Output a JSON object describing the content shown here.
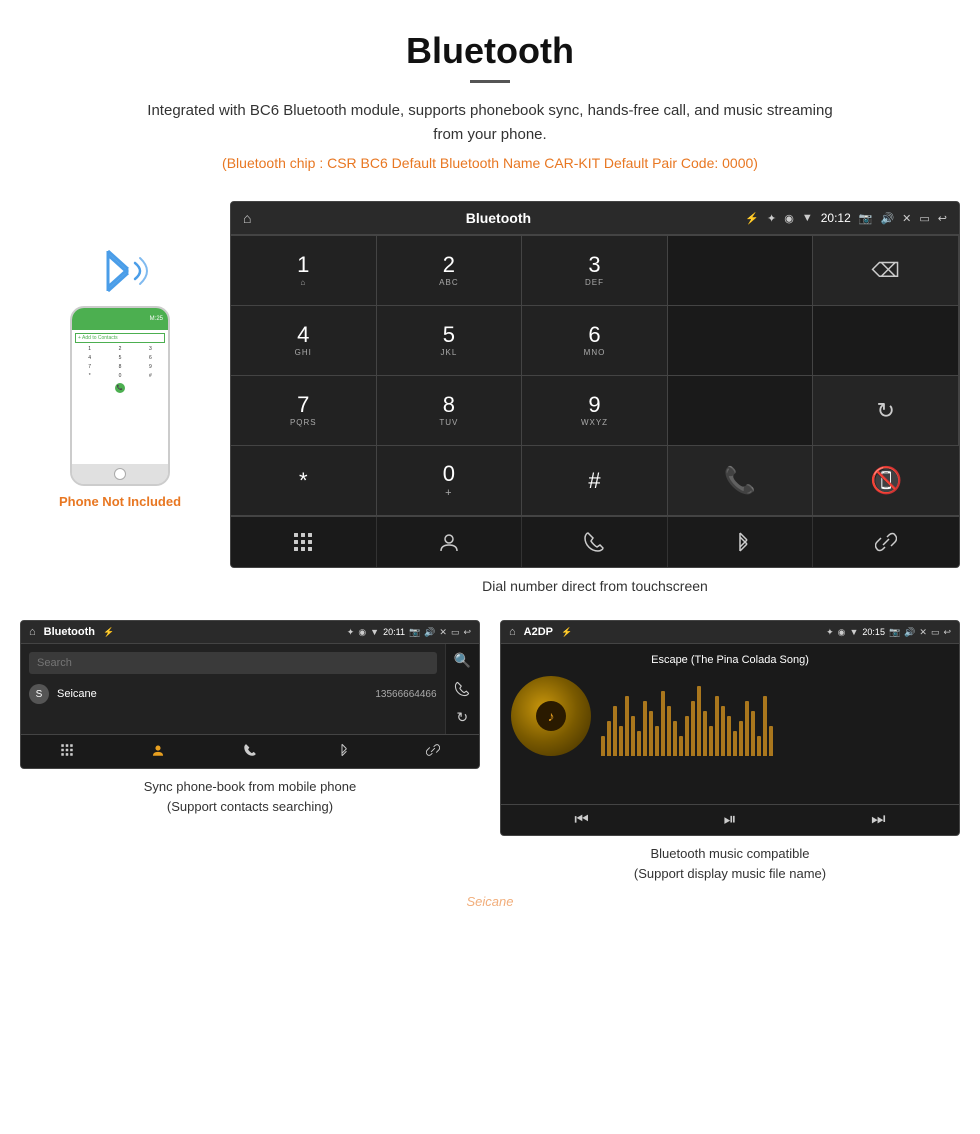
{
  "header": {
    "title": "Bluetooth",
    "description": "Integrated with BC6 Bluetooth module, supports phonebook sync, hands-free call, and music streaming from your phone.",
    "specs": "(Bluetooth chip : CSR BC6    Default Bluetooth Name CAR-KIT    Default Pair Code: 0000)"
  },
  "phone_sidebar": {
    "not_included": "Phone Not Included"
  },
  "dial_screen": {
    "title": "Bluetooth",
    "time": "20:12",
    "caption": "Dial number direct from touchscreen",
    "keys": [
      {
        "num": "1",
        "sub": ""
      },
      {
        "num": "2",
        "sub": "ABC"
      },
      {
        "num": "3",
        "sub": "DEF"
      },
      {
        "num": "4",
        "sub": "GHI"
      },
      {
        "num": "5",
        "sub": "JKL"
      },
      {
        "num": "6",
        "sub": "MNO"
      },
      {
        "num": "7",
        "sub": "PQRS"
      },
      {
        "num": "8",
        "sub": "TUV"
      },
      {
        "num": "9",
        "sub": "WXYZ"
      },
      {
        "num": "*",
        "sub": ""
      },
      {
        "num": "0",
        "sub": "+"
      },
      {
        "num": "#",
        "sub": ""
      }
    ]
  },
  "phonebook_screen": {
    "title": "Bluetooth",
    "time": "20:11",
    "search_placeholder": "Search",
    "contact_name": "Seicane",
    "contact_initial": "S",
    "contact_number": "13566664466",
    "caption": "Sync phone-book from mobile phone\n(Support contacts searching)"
  },
  "music_screen": {
    "title": "A2DP",
    "time": "20:15",
    "song_title": "Escape (The Pina Colada Song)",
    "caption": "Bluetooth music compatible\n(Support display music file name)"
  },
  "colors": {
    "orange": "#e87722",
    "green": "#4caf50",
    "red": "#f44336",
    "screen_bg": "#222222",
    "header_bg": "#2a2a2a"
  }
}
